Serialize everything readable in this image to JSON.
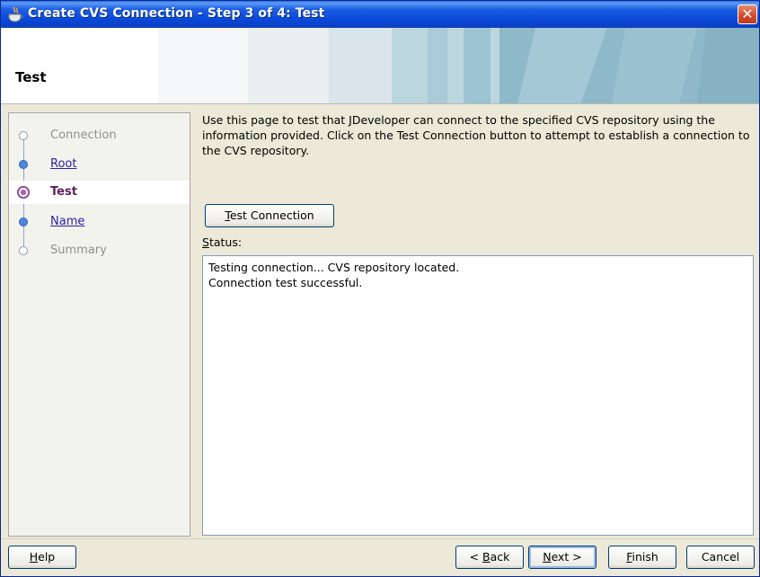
{
  "window": {
    "title": "Create CVS Connection - Step 3 of 4: Test",
    "close_glyph": "✕"
  },
  "header": {
    "title": "Test"
  },
  "nav": {
    "items": [
      {
        "label": "Connection",
        "state": "disabled"
      },
      {
        "label": "Root",
        "state": "link"
      },
      {
        "label": "Test",
        "state": "current"
      },
      {
        "label": "Name",
        "state": "link"
      },
      {
        "label": "Summary",
        "state": "disabled"
      }
    ]
  },
  "main": {
    "description": "Use this page to test that JDeveloper can connect to the specified CVS repository using the information provided. Click on the Test Connection button to attempt to establish a connection to the CVS repository.",
    "test_button": {
      "mnemonic": "T",
      "rest": "est Connection"
    },
    "status_label": {
      "mnemonic": "S",
      "rest": "tatus:"
    },
    "status_lines": [
      "Testing connection... CVS repository located.",
      "Connection test successful."
    ]
  },
  "footer": {
    "help": {
      "mnemonic": "H",
      "rest": "elp"
    },
    "back": {
      "prefix": "< ",
      "mnemonic": "B",
      "rest": "ack"
    },
    "next": {
      "mnemonic": "N",
      "rest": "ext >"
    },
    "finish": {
      "mnemonic": "F",
      "rest": "inish"
    },
    "cancel": {
      "label": "Cancel"
    }
  },
  "colors": {
    "titlebar": "#0a48d8",
    "link": "#2b1fa6",
    "current_step": "#5b1f63"
  }
}
